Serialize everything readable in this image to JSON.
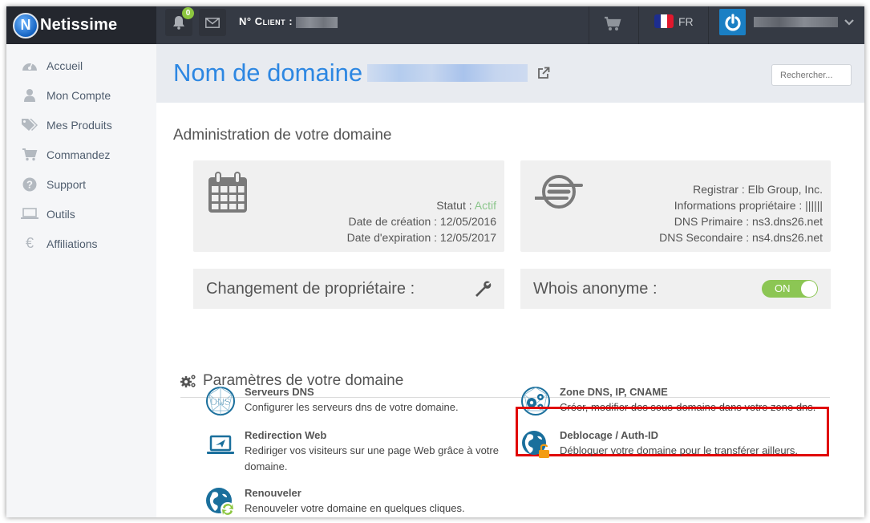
{
  "brand": {
    "initial": "N",
    "name": "Netissime"
  },
  "topbar": {
    "notifications_count": "0",
    "client_label": "N° Client :",
    "language": "FR",
    "flag_colors": [
      "#1d2d8f",
      "#ffffff",
      "#e1182d"
    ]
  },
  "sidebar": {
    "items": [
      {
        "label": "Accueil",
        "icon": "dashboard-icon"
      },
      {
        "label": "Mon Compte",
        "icon": "user-icon"
      },
      {
        "label": "Mes Produits",
        "icon": "tags-icon"
      },
      {
        "label": "Commandez",
        "icon": "cart-icon"
      },
      {
        "label": "Support",
        "icon": "question-icon"
      },
      {
        "label": "Outils",
        "icon": "laptop-icon"
      },
      {
        "label": "Affiliations",
        "icon": "euro-icon"
      }
    ]
  },
  "header": {
    "title": "Nom de domaine",
    "search_placeholder": "Rechercher..."
  },
  "admin": {
    "title": "Administration de votre domaine",
    "dates_card": {
      "status_label": "Statut :",
      "status_value": "Actif",
      "creation": "Date de création : 12/05/2016",
      "expiration": "Date d'expiration : 12/05/2017"
    },
    "registrar_card": {
      "registrar": "Registrar : Elb Group, Inc.",
      "owner_info": "Informations propriétaire : ||||||",
      "dns_primary": "DNS Primaire : ns3.dns26.net",
      "dns_secondary": "DNS Secondaire : ns4.dns26.net"
    },
    "owner_change_label": "Changement de propriétaire :",
    "whois_label": "Whois anonyme :",
    "whois_toggle": "ON"
  },
  "params": {
    "title": "Paramètres de votre domaine",
    "features": [
      {
        "title": "Serveurs DNS",
        "desc": "Configurer les serveurs dns de votre domaine."
      },
      {
        "title": "Zone DNS, IP, CNAME",
        "desc": "Créer, modifier des sous-domaine dans votre zone dns."
      },
      {
        "title": "Redirection Web",
        "desc": "Rediriger vos visiteurs sur une page Web grâce à votre domaine."
      },
      {
        "title": "Deblocage / Auth-ID",
        "desc": "Débloquer votre domaine pour le transférer ailleurs."
      },
      {
        "title": "Renouveler",
        "desc": "Renouveler votre domaine en quelques cliques."
      }
    ]
  },
  "colors": {
    "accent_blue": "#2d87e2",
    "active_green": "#8cc68c",
    "toggle_green": "#8cc654",
    "highlight_red": "#e00000",
    "icon_blue": "#1a6f9c"
  }
}
